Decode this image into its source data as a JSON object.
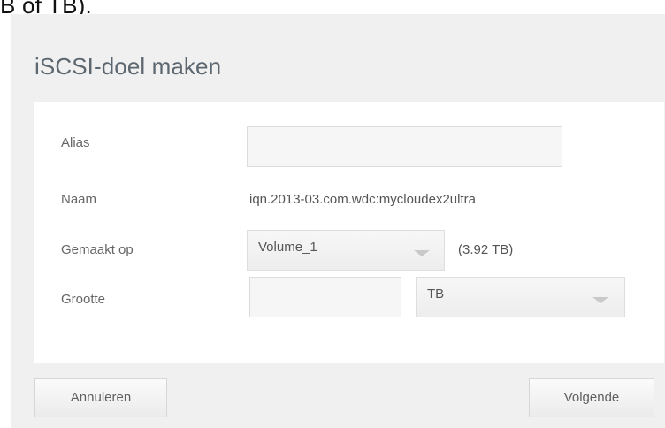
{
  "caption_fragment": "B of TB).",
  "dialog": {
    "title": "iSCSI-doel maken",
    "fields": {
      "alias": {
        "label": "Alias",
        "value": ""
      },
      "naam": {
        "label": "Naam",
        "value": "iqn.2013-03.com.wdc:mycloudex2ultra"
      },
      "gemaakt_op": {
        "label": "Gemaakt op",
        "selected": "Volume_1",
        "capacity": "(3.92 TB)"
      },
      "grootte": {
        "label": "Grootte",
        "value": "",
        "unit_selected": "TB"
      }
    },
    "buttons": {
      "cancel": "Annuleren",
      "next": "Volgende"
    }
  },
  "icons": {
    "volume_dropdown": "chevron-down-icon",
    "unit_dropdown": "chevron-down-icon"
  }
}
